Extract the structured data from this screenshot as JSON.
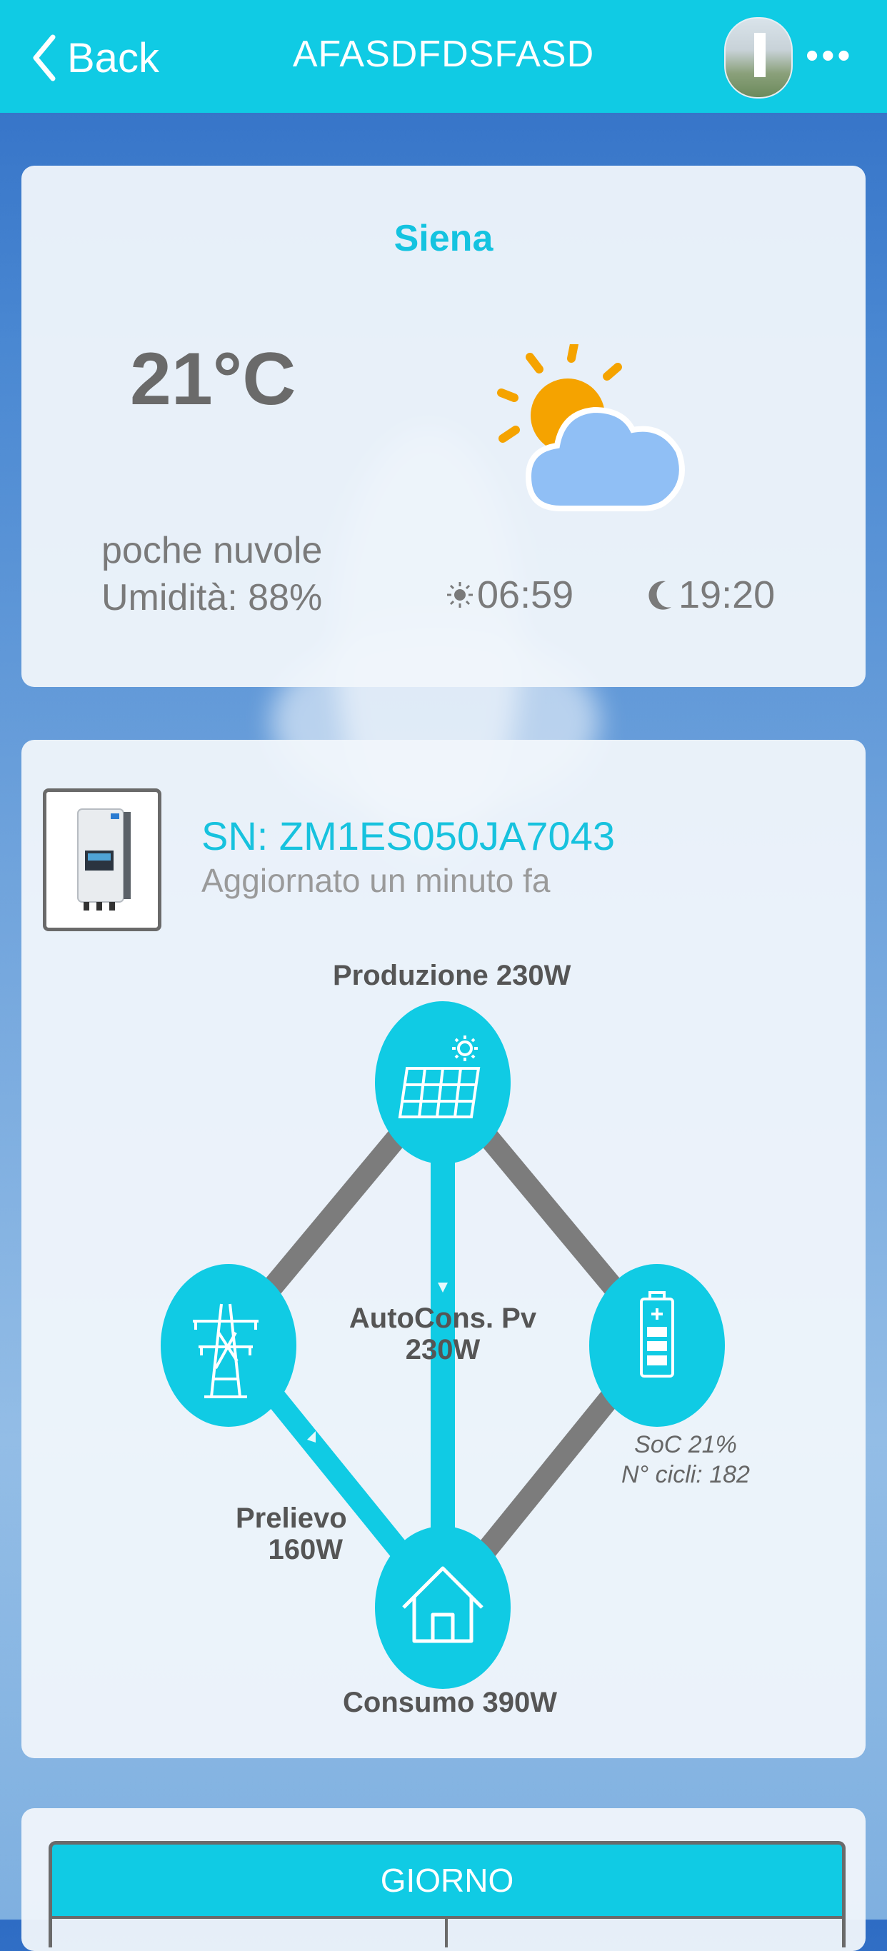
{
  "header": {
    "back_label": "Back",
    "title": "AFASDFDSFASD",
    "more_label": "•••"
  },
  "weather": {
    "city": "Siena",
    "temperature": "21°C",
    "description": "poche nuvole",
    "humidity": "Umidità: 88%",
    "sunrise": "06:59",
    "sunset": "19:20",
    "icon": "partly-cloudy-icon"
  },
  "device": {
    "serial": "SN: ZM1ES050JA7043",
    "updated": "Aggiornato un minuto fa",
    "flow": {
      "production": "Produzione  230W",
      "self_consumption_label": "AutoCons. Pv",
      "self_consumption_value": "230W",
      "grid_label": "Prelievo",
      "grid_value": "160W",
      "consumption": "Consumo  390W",
      "soc": "SoC 21%",
      "cycles": "N° cicli: 182"
    }
  },
  "period": {
    "tab_label": "GIORNO"
  },
  "colors": {
    "accent": "#10cbe4",
    "text_gray": "#7a7a7a",
    "line_gray": "#7a7a7a"
  }
}
